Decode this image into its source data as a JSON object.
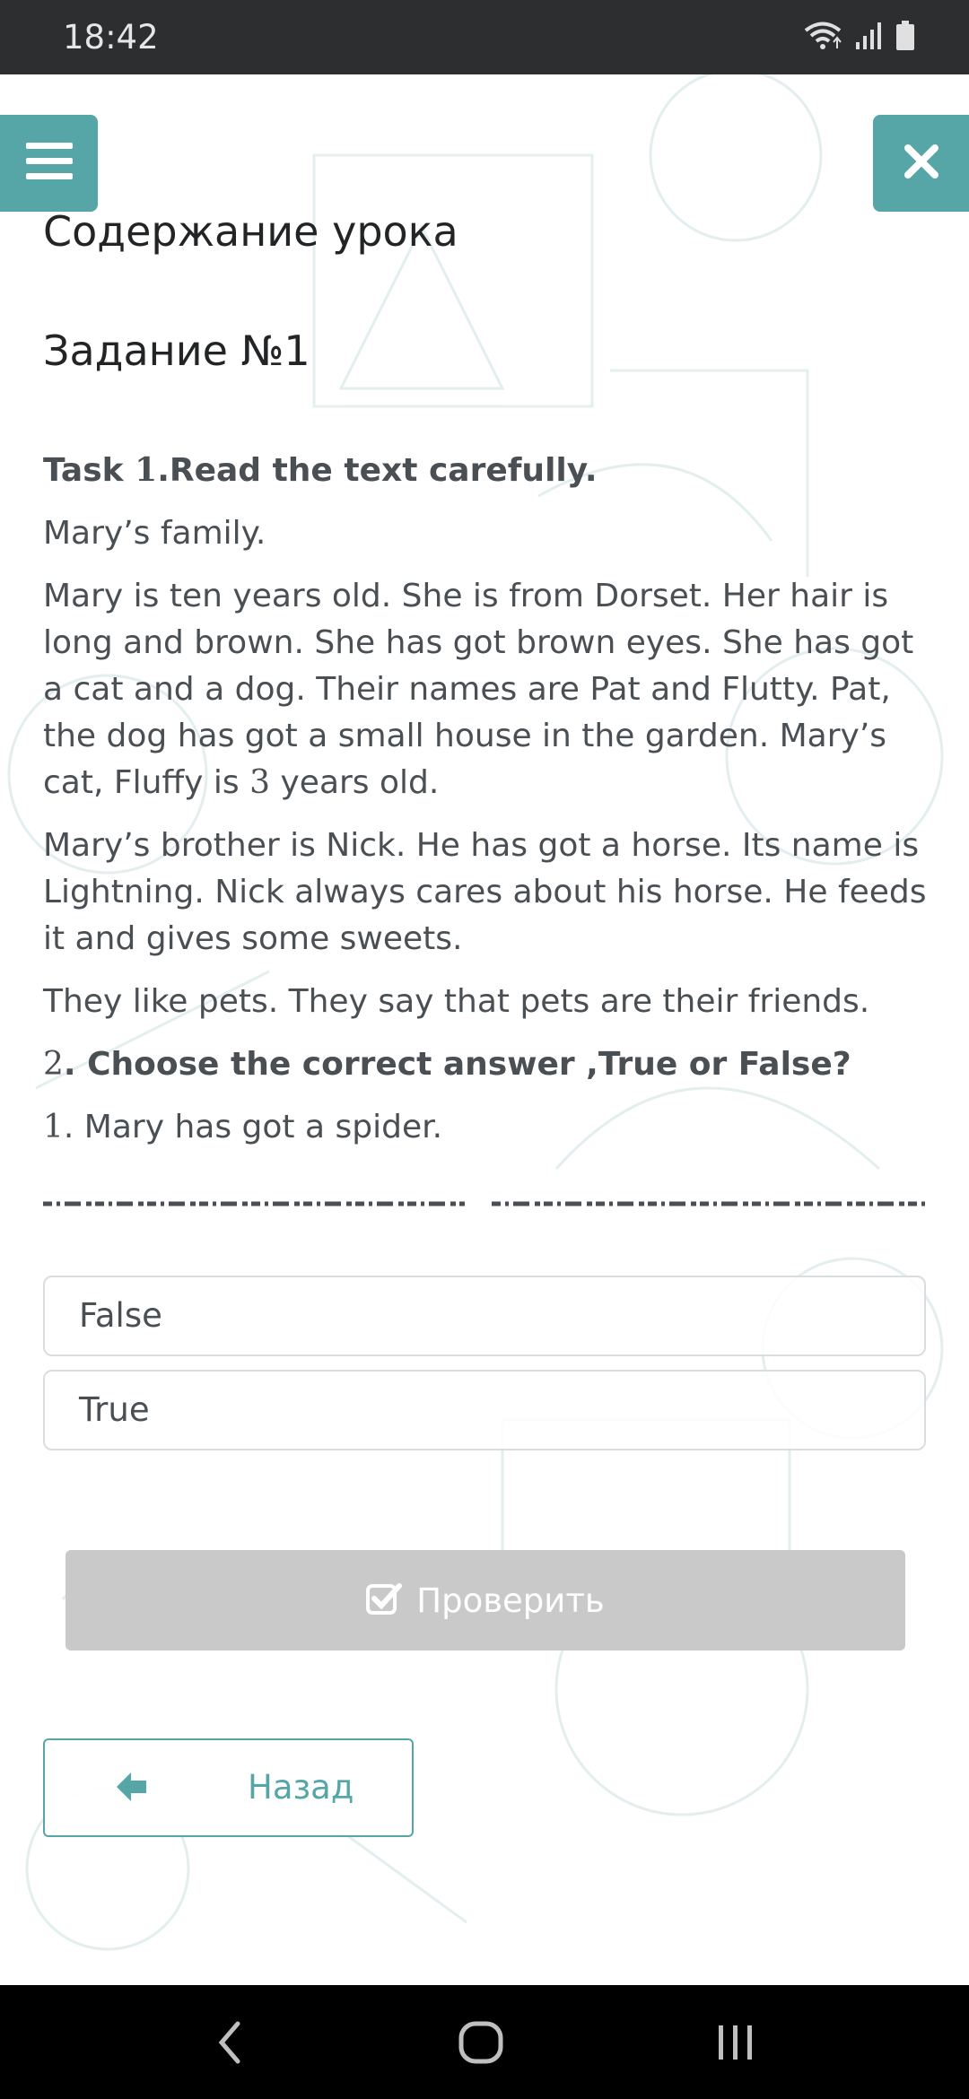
{
  "status_bar": {
    "time": "18:42",
    "icons": [
      "wifi-icon",
      "signal-icon",
      "battery-icon"
    ]
  },
  "header": {
    "menu_icon": "hamburger-icon",
    "close_icon": "close-icon",
    "lesson_title": "Содержание урока",
    "task_title": "Задание №1"
  },
  "content": {
    "task_prefix": "Task ",
    "task_number": "1",
    "task_instruction": ".Read the text carefully.",
    "story_title": "Mary’s family.",
    "paragraph_1_a": "Mary is ten years old. She is from Dorset. Her hair is long and brown. She has got brown eyes. She has got a cat and a dog. Their names are Pat and Flutty. Pat, the dog has got a small house in the garden. Mary’s cat, Fluffy is ",
    "paragraph_1_num": "3",
    "paragraph_1_b": " years old.",
    "paragraph_2": "Mary’s brother is Nick. He has got a horse. Its name is Lightning. Nick always cares about his horse. He feeds it and gives some sweets.",
    "paragraph_3": "They like pets. They say that pets are their friends.",
    "question_number": "2",
    "question_text": ". Choose the correct answer ,True or False?",
    "statement_number": "1",
    "statement_text": ". Mary has got a spider."
  },
  "options": [
    {
      "label": "False"
    },
    {
      "label": "True"
    }
  ],
  "check_button": {
    "icon": "checkbox-icon",
    "label": "Проверить"
  },
  "back_button": {
    "icon": "arrow-left-icon",
    "label": "Назад"
  },
  "nav_bar": {
    "items": [
      "back-nav-icon",
      "home-nav-icon",
      "recents-nav-icon"
    ]
  },
  "colors": {
    "accent": "#56a6a8",
    "status_bar": "#2d2e30",
    "check_button_disabled": "#c9c9c9"
  }
}
